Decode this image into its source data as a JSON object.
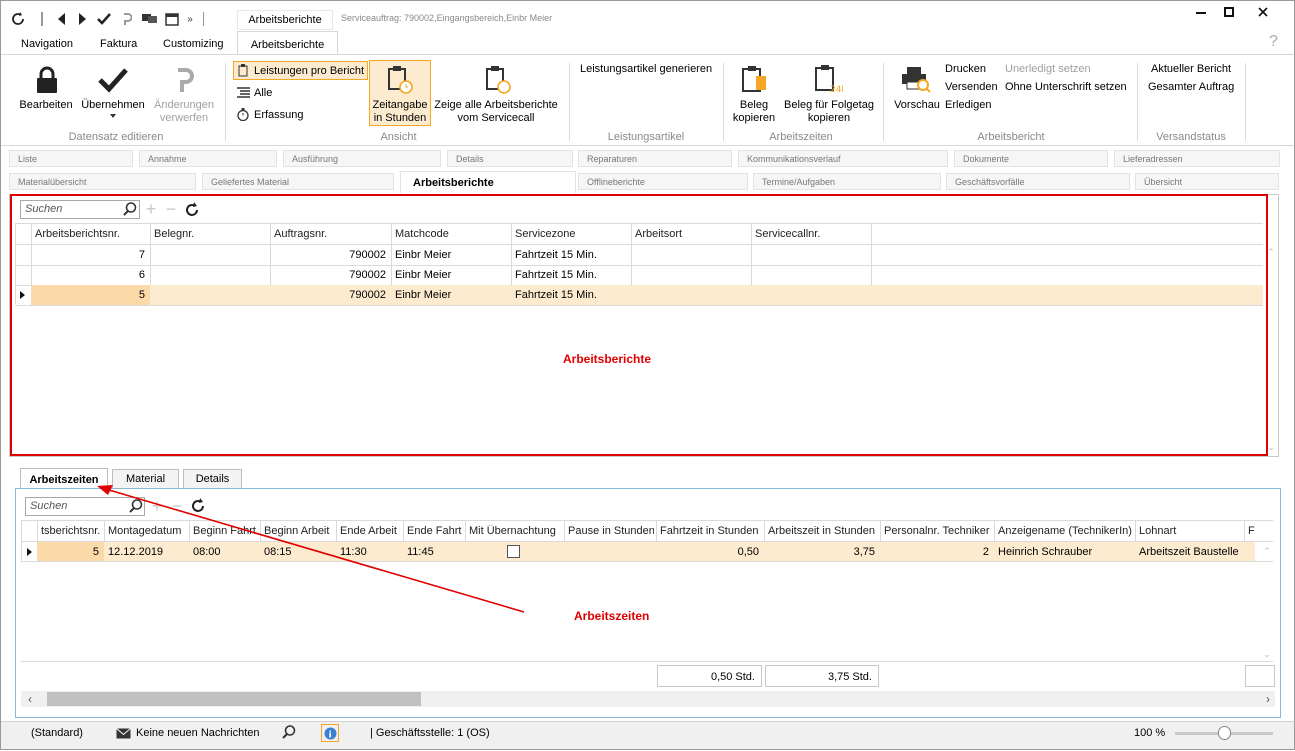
{
  "titlebar": {
    "tab_title": "Arbeitsberichte",
    "caption": "Serviceauftrag: 790002,Eingangsbereich,Einbr Meier"
  },
  "menu": {
    "navigation": "Navigation",
    "faktura": "Faktura",
    "customizing": "Customizing",
    "arbeitsberichte": "Arbeitsberichte",
    "help": "?"
  },
  "ribbon": {
    "bearbeiten": "Bearbeiten",
    "uebernehmen": "Übernehmen",
    "aenderungen": "Änderungen",
    "verwerfen": "verwerfen",
    "group_datensatz": "Datensatz editieren",
    "leistungen_pro_bericht": "Leistungen pro Bericht",
    "alle": "Alle",
    "erfassung": "Erfassung",
    "zeitangabe": "Zeitangabe",
    "in_stunden": "in Stunden",
    "zeige_alle": "Zeige alle Arbeitsberichte",
    "vom_servicecall": "vom Servicecall",
    "group_ansicht": "Ansicht",
    "leistungsartikel_generieren": "Leistungsartikel generieren",
    "group_leistungsartikel": "Leistungsartikel",
    "beleg": "Beleg",
    "kopieren": "kopieren",
    "beleg_folgetag": "Beleg für Folgetag",
    "kopieren2": "kopieren",
    "group_arbeitszeiten": "Arbeitszeiten",
    "vorschau": "Vorschau",
    "drucken": "Drucken",
    "versenden": "Versenden",
    "erledigen": "Erledigen",
    "unerledigt": "Unerledigt setzen",
    "ohne_unterschrift": "Ohne Unterschrift setzen",
    "group_arbeitsbericht": "Arbeitsbericht",
    "aktueller_bericht": "Aktueller Bericht",
    "gesamter_auftrag": "Gesamter Auftrag",
    "group_versandstatus": "Versandstatus"
  },
  "navtabs_row1": [
    "Liste",
    "Annahme",
    "Ausführung",
    "Details",
    "Reparaturen",
    "Kommunikationsverlauf",
    "Dokumente",
    "Lieferadressen"
  ],
  "navtabs_row2": [
    "Materialübersicht",
    "Geliefertes Material",
    "Arbeitsberichte",
    "Offlineberichte",
    "Termine/Aufgaben",
    "Geschäftsvorfälle",
    "Übersicht"
  ],
  "top_grid": {
    "search_placeholder": "Suchen",
    "headers": [
      "Arbeitsberichtsnr.",
      "Belegnr.",
      "Auftragsnr.",
      "Matchcode",
      "Servicezone",
      "Arbeitsort",
      "Servicecallnr."
    ],
    "rows": [
      [
        "7",
        "",
        "790002",
        "Einbr Meier",
        "Fahrtzeit 15 Min.",
        "",
        ""
      ],
      [
        "6",
        "",
        "790002",
        "Einbr Meier",
        "Fahrtzeit 15 Min.",
        "",
        ""
      ],
      [
        "5",
        "",
        "790002",
        "Einbr Meier",
        "Fahrtzeit 15 Min.",
        "",
        ""
      ]
    ],
    "annotation": "Arbeitsberichte"
  },
  "sub_tabs": [
    "Arbeitszeiten",
    "Material",
    "Details"
  ],
  "bottom_grid": {
    "search_placeholder": "Suchen",
    "headers": [
      "tsberichtsnr.",
      "Montagedatum",
      "Beginn Fahrt",
      "Beginn Arbeit",
      "Ende Arbeit",
      "Ende Fahrt",
      "Mit Übernachtung",
      "Pause in Stunden",
      "Fahrtzeit in Stunden",
      "Arbeitszeit in Stunden",
      "Personalnr. Techniker",
      "Anzeigename (TechnikerIn)",
      "Lohnart",
      "Fi"
    ],
    "row": [
      "5",
      "12.12.2019",
      "08:00",
      "08:15",
      "11:30",
      "11:45",
      "",
      "",
      "0,50",
      "3,75",
      "2",
      "Heinrich Schrauber",
      "Arbeitszeit Baustelle",
      ""
    ],
    "sum_fahrt": "0,50 Std.",
    "sum_arbeit": "3,75 Std.",
    "annotation": "Arbeitszeiten"
  },
  "status": {
    "standard": "(Standard)",
    "nachrichten": "Keine neuen Nachrichten",
    "geschaeftsstelle": "| Geschäftsstelle: 1 (OS)",
    "zoom": "100 %"
  },
  "colors": {
    "accent": "#f5a623",
    "selection": "#fdebd0",
    "annotation": "#e00000",
    "frame": "#88b8d8"
  }
}
